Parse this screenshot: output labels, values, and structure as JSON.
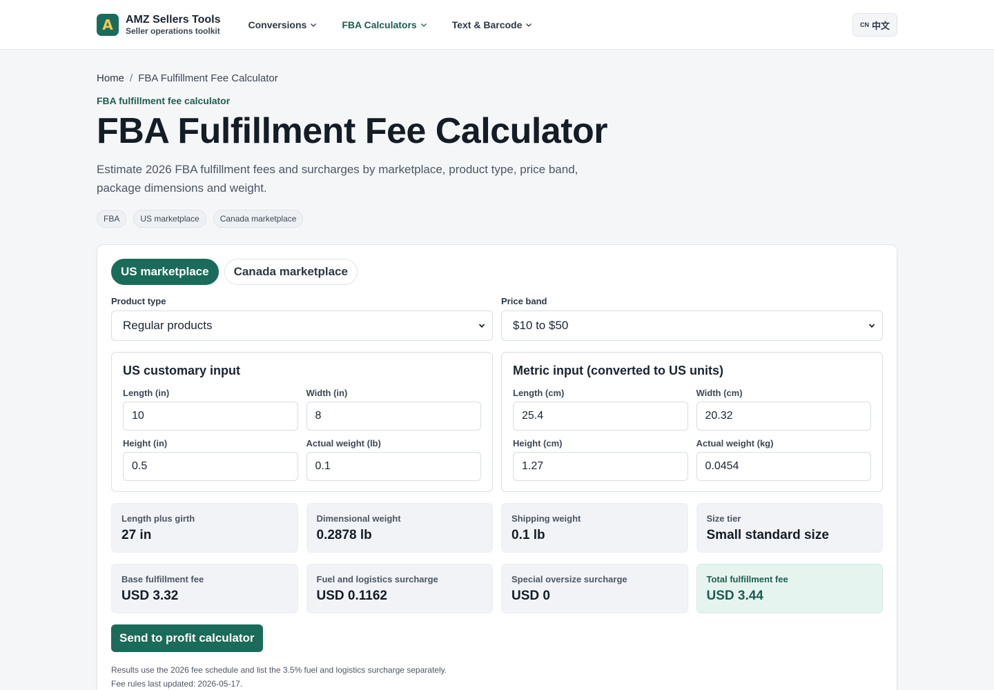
{
  "header": {
    "brand_initial": "A",
    "brand_name": "AMZ Sellers Tools",
    "brand_tagline": "Seller operations toolkit",
    "nav": [
      {
        "label": "Conversions"
      },
      {
        "label": "FBA Calculators"
      },
      {
        "label": "Text & Barcode"
      }
    ],
    "lang_flag": "CN",
    "lang_label": "中文"
  },
  "breadcrumb": {
    "home": "Home",
    "separator": "/",
    "current": "FBA Fulfillment Fee Calculator"
  },
  "page": {
    "eyebrow": "FBA fulfillment fee calculator",
    "title": "FBA Fulfillment Fee Calculator",
    "lead": "Estimate 2026 FBA fulfillment fees and surcharges by marketplace, product type, price band, package dimensions and weight.",
    "chips": [
      "FBA",
      "US marketplace",
      "Canada marketplace"
    ]
  },
  "calculator": {
    "tabs": [
      {
        "label": "US marketplace",
        "active": true
      },
      {
        "label": "Canada marketplace",
        "active": false
      }
    ],
    "product_type": {
      "label": "Product type",
      "value": "Regular products"
    },
    "price_band": {
      "label": "Price band",
      "value": "$10 to $50"
    },
    "us_input": {
      "title": "US customary input",
      "length": {
        "label": "Length (in)",
        "value": "10"
      },
      "width": {
        "label": "Width (in)",
        "value": "8"
      },
      "height": {
        "label": "Height (in)",
        "value": "0.5"
      },
      "weight": {
        "label": "Actual weight (lb)",
        "value": "0.1"
      }
    },
    "metric_input": {
      "title": "Metric input (converted to US units)",
      "length": {
        "label": "Length (cm)",
        "value": "25.4"
      },
      "width": {
        "label": "Width (cm)",
        "value": "20.32"
      },
      "height": {
        "label": "Height (cm)",
        "value": "1.27"
      },
      "weight": {
        "label": "Actual weight (kg)",
        "value": "0.0454"
      }
    },
    "results_row1": [
      {
        "label": "Length plus girth",
        "value": "27 in"
      },
      {
        "label": "Dimensional weight",
        "value": "0.2878 lb"
      },
      {
        "label": "Shipping weight",
        "value": "0.1 lb"
      },
      {
        "label": "Size tier",
        "value": "Small standard size"
      }
    ],
    "results_row2": [
      {
        "label": "Base fulfillment fee",
        "value": "USD 3.32"
      },
      {
        "label": "Fuel and logistics surcharge",
        "value": "USD 0.1162"
      },
      {
        "label": "Special oversize surcharge",
        "value": "USD 0"
      },
      {
        "label": "Total fulfillment fee",
        "value": "USD 3.44"
      }
    ],
    "send_button": "Send to profit calculator",
    "note1": "Results use the 2026 fee schedule and list the 3.5% fuel and logistics surcharge separately.",
    "note2": "Fee rules last updated: 2026-05-17."
  },
  "colors": {
    "accent": "#1b6b5a",
    "logo_letter": "#f2c94c",
    "total_bg": "#e6f4ef"
  }
}
